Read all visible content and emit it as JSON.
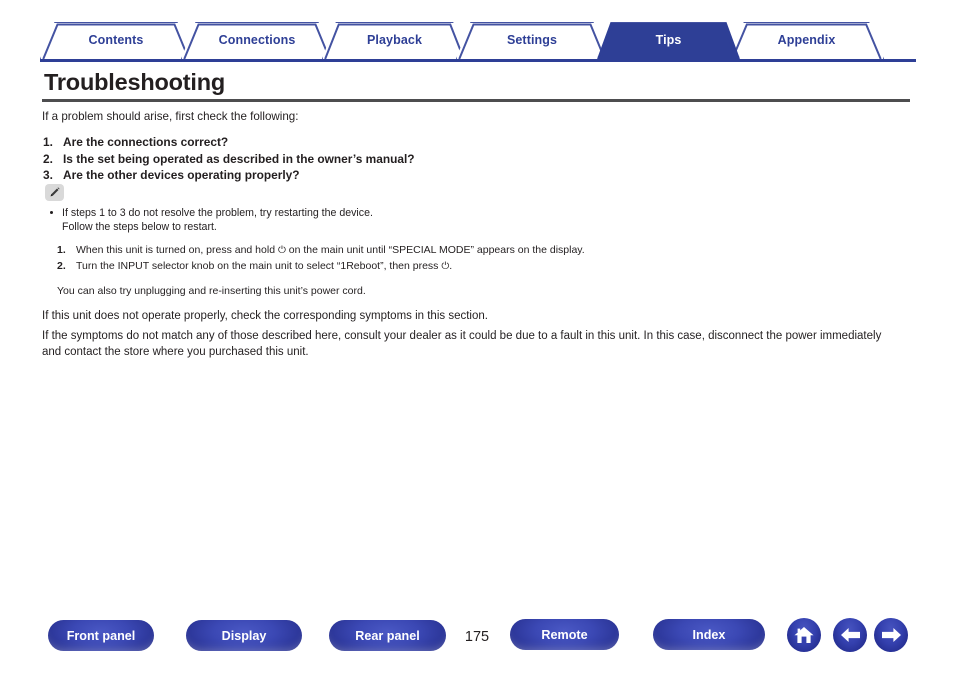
{
  "tabs": [
    {
      "label": "Contents",
      "name": "tab-contents",
      "active": false
    },
    {
      "label": "Connections",
      "name": "tab-connections",
      "active": false
    },
    {
      "label": "Playback",
      "name": "tab-playback",
      "active": false
    },
    {
      "label": "Settings",
      "name": "tab-settings",
      "active": false
    },
    {
      "label": "Tips",
      "name": "tab-tips",
      "active": true
    },
    {
      "label": "Appendix",
      "name": "tab-appendix",
      "active": false
    }
  ],
  "page": {
    "title": "Troubleshooting",
    "lead": "If a problem should arise, first check the following:",
    "checklist": [
      {
        "num": "1.",
        "text": "Are the connections correct?"
      },
      {
        "num": "2.",
        "text": "Is the set being operated as described in the owner’s manual?"
      },
      {
        "num": "3.",
        "text": "Are the other devices operating properly?"
      }
    ],
    "note": {
      "icon": "pencil-icon",
      "bullet": "If steps 1 to 3 do not resolve the problem, try restarting the device.",
      "bullet_cont": "Follow the steps below to restart.",
      "steps": [
        {
          "num": "1.",
          "pre": "When this unit is turned on, press and hold ",
          "sym": "⏻",
          "post": " on the main unit until “SPECIAL MODE” appears on the display."
        },
        {
          "num": "2.",
          "pre": "Turn the INPUT selector knob on the main unit to select “1Reboot”, then press ",
          "sym": "⏻",
          "post": "."
        }
      ],
      "also": "You can also try unplugging and re-inserting this unit’s power cord."
    },
    "tail_1": "If this unit does not operate properly, check the corresponding symptoms in this section.",
    "tail_2": "If the symptoms do not match any of those described here, consult your dealer as it could be due to a fault in this unit. In this case, disconnect the power immediately and contact the store where you purchased this unit."
  },
  "footer": {
    "buttons": [
      {
        "label": "Front panel",
        "name": "front-panel-button"
      },
      {
        "label": "Display",
        "name": "display-button"
      },
      {
        "label": "Rear panel",
        "name": "rear-panel-button"
      },
      {
        "label": "Remote",
        "name": "remote-button"
      },
      {
        "label": "Index",
        "name": "index-button"
      }
    ],
    "page_number": "175",
    "icons": [
      {
        "name": "home-icon"
      },
      {
        "name": "arrow-left-icon"
      },
      {
        "name": "arrow-right-icon"
      }
    ]
  },
  "colors": {
    "brand_blue": "#2e3f96",
    "tab_border": "#4453a2",
    "rule_gray": "#4d4d4f",
    "text": "#231f20"
  }
}
